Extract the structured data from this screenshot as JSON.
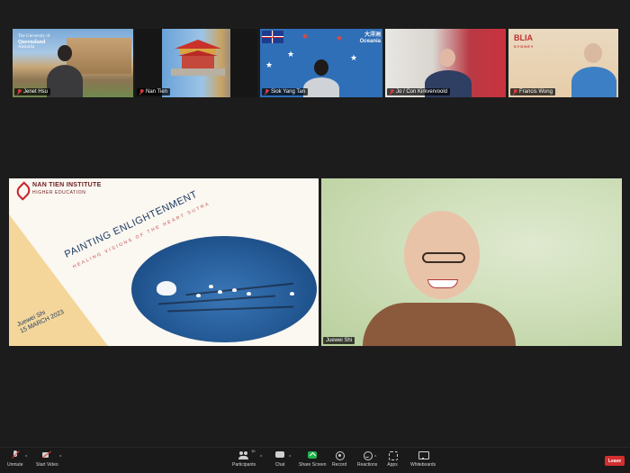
{
  "participants": [
    {
      "name": "Jenet Hsu",
      "muted": true,
      "org_logo": [
        "The University of",
        "Queensland",
        "Australia"
      ]
    },
    {
      "name": "Nan Tien",
      "muted": true
    },
    {
      "name": "Siok Yang Tan",
      "muted": true,
      "org_logo": [
        "大洋洲",
        "Oceania"
      ]
    },
    {
      "name": "Jo / Con Kirkvervoold",
      "muted": true
    },
    {
      "name": "Francis Wong",
      "muted": true,
      "org_logo": [
        "BLIA",
        "SYDNEY"
      ]
    },
    {
      "name": "Juewei Shi",
      "muted": false
    }
  ],
  "slide": {
    "institute": "NAN TIEN INSTITUTE",
    "institute_sub": "HIGHER EDUCATION",
    "title": "PAINTING ENLIGHTENMENT",
    "subtitle": "HEALING VISIONS OF THE HEART SUTRA",
    "author": "Juewei Shi",
    "date": "15 MARCH 2023"
  },
  "toolbar": {
    "unmute": "Unmute",
    "start_video": "Start Video",
    "participants": "Participants",
    "participants_count": "10",
    "chat": "Chat",
    "share_screen": "Share Screen",
    "record": "Record",
    "reactions": "Reactions",
    "apps": "Apps",
    "whiteboards": "Whiteboards",
    "leave": "Leave"
  },
  "colors": {
    "leave": "#d32f2f",
    "share": "#22b24c",
    "muted_mic": "#e03b3b"
  }
}
